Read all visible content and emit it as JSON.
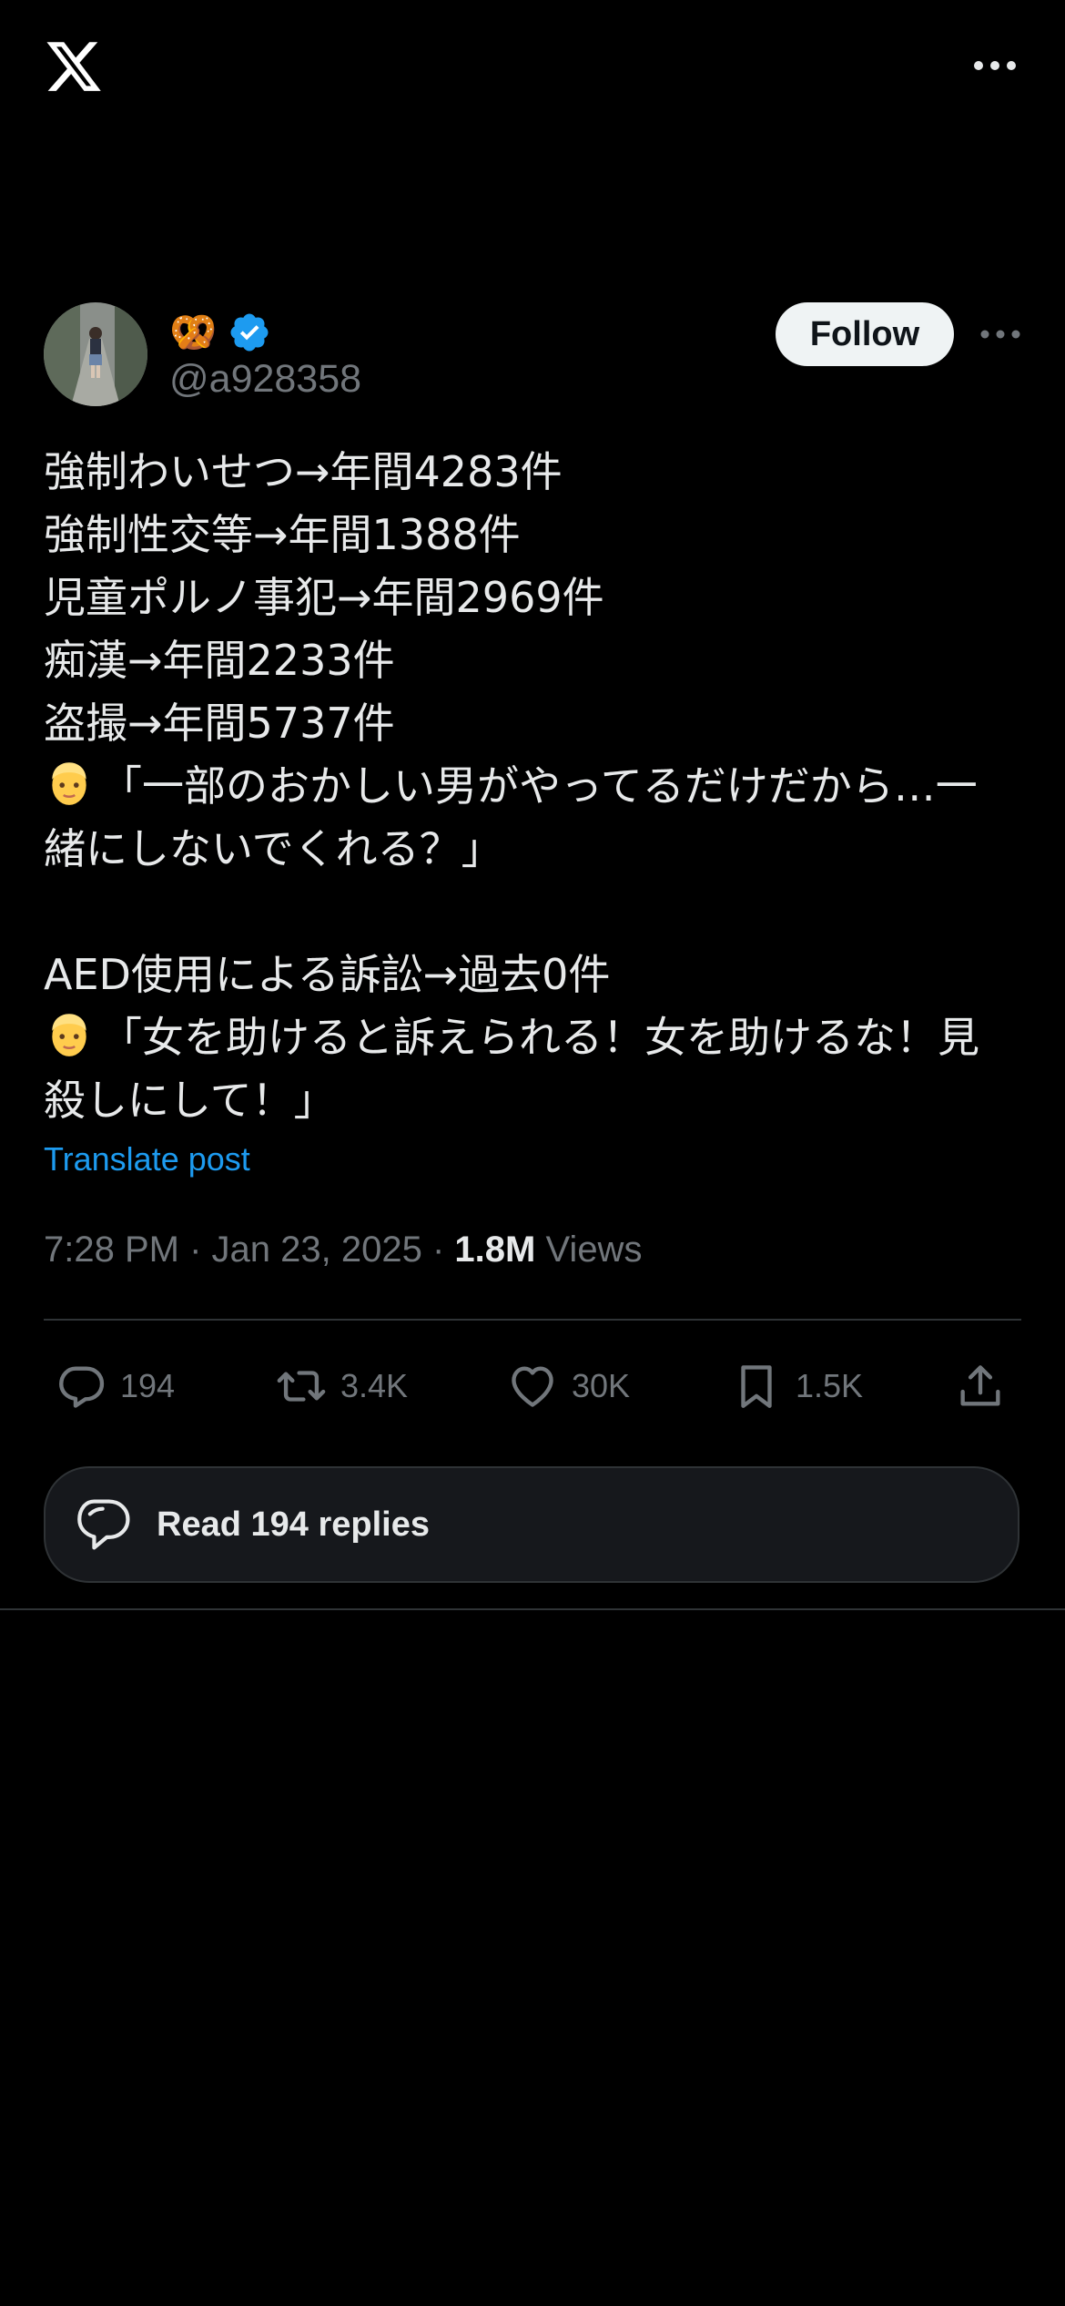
{
  "topbar": {
    "logo_icon": "x-logo-icon",
    "more_icon": "more-horizontal-icon"
  },
  "author": {
    "display_name_emoji": "🥨",
    "verified": true,
    "verified_color": "#1d9bf0",
    "handle": "@a928358",
    "follow_label": "Follow"
  },
  "tweet": {
    "lines": [
      "強制わいせつ→年間4283件",
      "強制性交等→年間1388件",
      "児童ポルノ事犯→年間2969件",
      "痴漢→年間2233件",
      "盗撮→年間5737件"
    ],
    "quote1_line1": "「一部のおかしい男がやってるだけだから…一",
    "quote1_line2": "緒にしないでくれる？」",
    "line_aed": "AED使用による訴訟→過去0件",
    "quote2_line1": "「女を助けると訴えられる！女を助けるな！見",
    "quote2_line2": "殺しにして！」",
    "emoji_icon": "man-face-emoji-icon"
  },
  "translate_label": "Translate post",
  "meta": {
    "time": "7:28 PM",
    "date": "Jan 23, 2025",
    "views_count": "1.8M",
    "views_label": "Views"
  },
  "actions": {
    "replies": "194",
    "reposts": "3.4K",
    "likes": "30K",
    "bookmarks": "1.5K"
  },
  "read_replies_label": "Read 194 replies",
  "colors": {
    "background": "#000000",
    "accent": "#1d9bf0",
    "muted": "#71767b",
    "text": "#e7e9ea"
  }
}
